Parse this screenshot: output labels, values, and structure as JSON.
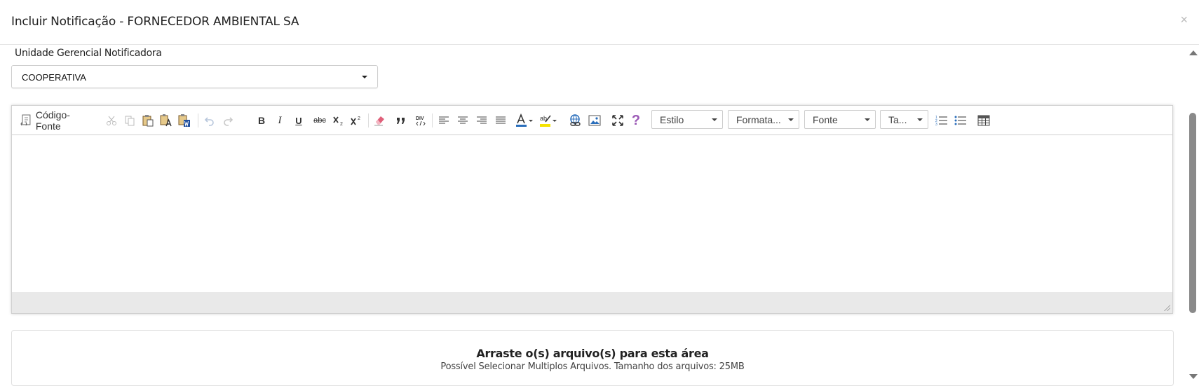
{
  "dialog": {
    "title": "Incluir Notificação - FORNECEDOR AMBIENTAL SA",
    "close_symbol": "×"
  },
  "form": {
    "unit_label": "Unidade Gerencial Notificadora",
    "unit_value": "COOPERATIVA"
  },
  "editor": {
    "source_button_label": "Código-Fonte",
    "combos": {
      "style": "Estilo",
      "format": "Formata...",
      "font": "Fonte",
      "size": "Ta..."
    },
    "bold_glyph": "B",
    "italic_glyph": "I",
    "underline_glyph": "U",
    "strike_glyph": "abc",
    "help_glyph": "?",
    "content": ""
  },
  "upload": {
    "title": "Arraste o(s) arquivo(s) para esta área",
    "subtitle": "Possível Selecionar Multiplos Arquivos. Tamanho dos arquivos: 25MB"
  },
  "colors": {
    "accent_blue": "#2a6ebb",
    "help_purple": "#9b59b6",
    "highlight_yellow": "#f5e300",
    "eraser_pink": "#e0607a"
  }
}
